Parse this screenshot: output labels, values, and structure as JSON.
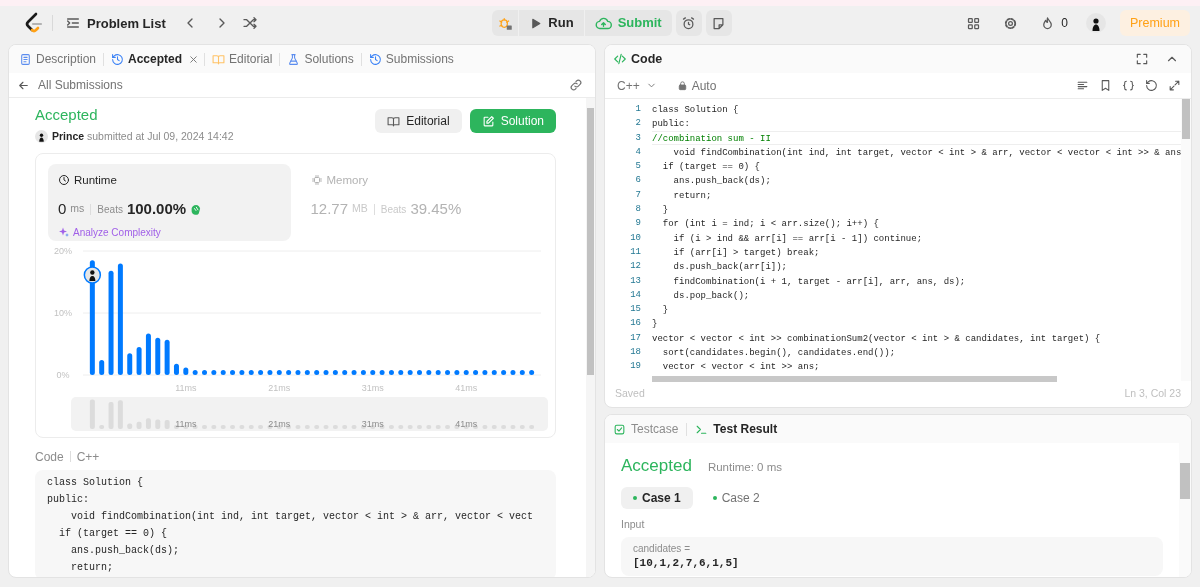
{
  "top_bar": {
    "problem_list": "Problem List",
    "run": "Run",
    "submit": "Submit",
    "streak": "0",
    "premium": "Premium"
  },
  "left_tabs": [
    {
      "label": "Description",
      "selected": false,
      "closable": false
    },
    {
      "label": "Accepted",
      "selected": true,
      "closable": true
    },
    {
      "label": "Editorial",
      "selected": false,
      "closable": false
    },
    {
      "label": "Solutions",
      "selected": false,
      "closable": false
    },
    {
      "label": "Submissions",
      "selected": false,
      "closable": false
    }
  ],
  "back_link": "All Submissions",
  "submission": {
    "status": "Accepted",
    "user": "Prince",
    "submitted": "submitted at Jul 09, 2024 14:42",
    "buttons": [
      {
        "label": "Editorial",
        "kind": "secondary"
      },
      {
        "label": "Solution",
        "kind": "primary"
      }
    ]
  },
  "stats": [
    {
      "title": "Runtime",
      "selected": true,
      "value": "0",
      "unit": "ms",
      "beats_label": "Beats",
      "beats": "100.00%",
      "award": true,
      "action": "Analyze Complexity"
    },
    {
      "title": "Memory",
      "selected": false,
      "value": "12.77",
      "unit": "MB",
      "beats_label": "Beats",
      "beats": "39.45%"
    }
  ],
  "chart_data": {
    "type": "bar",
    "x": [
      1,
      2,
      3,
      4,
      5,
      6,
      7,
      8,
      9,
      10,
      11,
      12,
      13,
      14,
      15,
      16,
      17,
      18,
      19,
      20,
      21,
      22,
      23,
      24,
      25,
      26,
      27,
      28,
      29,
      30,
      31,
      32,
      33,
      34,
      35,
      36,
      37,
      38,
      39,
      40,
      41,
      42,
      43,
      44,
      45,
      46,
      47,
      48
    ],
    "values": [
      18.5,
      2.4,
      16.8,
      18,
      3.5,
      4.5,
      6.7,
      6,
      5.7,
      1.8,
      1.2,
      0.8,
      0.8,
      0.8,
      0.8,
      0.8,
      0.8,
      0.8,
      0.8,
      0.8,
      0.8,
      0.8,
      0.8,
      0.8,
      0.8,
      0.8,
      0.8,
      0.8,
      0.8,
      0.8,
      0.8,
      0.8,
      0.8,
      0.8,
      0.8,
      0.8,
      0.8,
      0.8,
      0.8,
      0.8,
      0.8,
      0.8,
      0.8,
      0.8,
      0.8,
      0.8,
      0.8,
      0.8
    ],
    "xticks": [
      {
        "value": 11,
        "label": "11ms"
      },
      {
        "value": 21,
        "label": "21ms"
      },
      {
        "value": 31,
        "label": "31ms"
      },
      {
        "value": 41,
        "label": "41ms"
      }
    ],
    "yticks": [
      {
        "value": 0,
        "label": "0%"
      },
      {
        "value": 10,
        "label": "10%"
      },
      {
        "value": 20,
        "label": "20%"
      }
    ],
    "xlim": [
      0,
      49
    ],
    "ylim": [
      0,
      20
    ]
  },
  "overview_labels": [
    "11ms",
    "21ms",
    "31ms",
    "41ms"
  ],
  "code_preview": {
    "title": "Code",
    "language": "C++",
    "lines": [
      "class Solution {",
      "public:",
      "    void findCombination(int ind, int target, vector < int > & arr, vector < vect",
      "  if (target == 0) {",
      "    ans.push_back(ds);",
      "    return;"
    ]
  },
  "editor": {
    "title": "Code",
    "language": "C++",
    "mode": "Auto",
    "status": "Saved",
    "cursor": "Ln 3, Col 23",
    "lines": [
      {
        "number": "1",
        "text": "class Solution {",
        "kind": "code",
        "current": false
      },
      {
        "number": "2",
        "text": "public:",
        "kind": "code",
        "current": false
      },
      {
        "number": "3",
        "text": "//combination sum - II",
        "kind": "comment",
        "current": true
      },
      {
        "number": "4",
        "text": "    void findCombination(int ind, int target, vector < int > & arr, vector < vector < int >> & ans",
        "kind": "code",
        "current": false
      },
      {
        "number": "5",
        "text": "  if (target == 0) {",
        "kind": "code",
        "current": false
      },
      {
        "number": "6",
        "text": "    ans.push_back(ds);",
        "kind": "code",
        "current": false
      },
      {
        "number": "7",
        "text": "    return;",
        "kind": "code",
        "current": false
      },
      {
        "number": "8",
        "text": "  }",
        "kind": "code",
        "current": false
      },
      {
        "number": "9",
        "text": "  for (int i = ind; i < arr.size(); i++) {",
        "kind": "code",
        "current": false
      },
      {
        "number": "10",
        "text": "    if (i > ind && arr[i] == arr[i - 1]) continue;",
        "kind": "code",
        "current": false
      },
      {
        "number": "11",
        "text": "    if (arr[i] > target) break;",
        "kind": "code",
        "current": false
      },
      {
        "number": "12",
        "text": "    ds.push_back(arr[i]);",
        "kind": "code",
        "current": false
      },
      {
        "number": "13",
        "text": "    findCombination(i + 1, target - arr[i], arr, ans, ds);",
        "kind": "code",
        "current": false
      },
      {
        "number": "14",
        "text": "    ds.pop_back();",
        "kind": "code",
        "current": false
      },
      {
        "number": "15",
        "text": "  }",
        "kind": "code",
        "current": false
      },
      {
        "number": "16",
        "text": "}",
        "kind": "code",
        "current": false
      },
      {
        "number": "17",
        "text": "vector < vector < int >> combinationSum2(vector < int > & candidates, int target) {",
        "kind": "code",
        "current": false
      },
      {
        "number": "18",
        "text": "  sort(candidates.begin(), candidates.end());",
        "kind": "code",
        "current": false
      },
      {
        "number": "19",
        "text": "  vector < vector < int >> ans;",
        "kind": "code",
        "current": false
      }
    ]
  },
  "results": {
    "tabs": [
      {
        "label": "Testcase",
        "selected": false
      },
      {
        "label": "Test Result",
        "selected": true
      }
    ],
    "status": "Accepted",
    "runtime": "Runtime: 0 ms",
    "cases": [
      {
        "label": "Case 1",
        "selected": true
      },
      {
        "label": "Case 2",
        "selected": false
      }
    ],
    "input_label": "Input",
    "param": "candidates =",
    "value": "[10,1,2,7,6,1,5]"
  }
}
